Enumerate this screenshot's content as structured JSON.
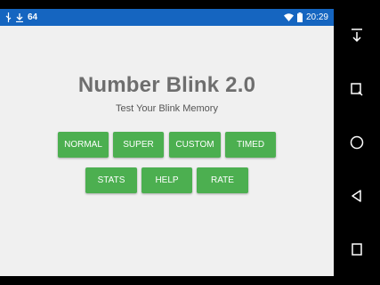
{
  "status_bar": {
    "notification_count": "64",
    "time": "20:29"
  },
  "app": {
    "title": "Number Blink 2.0",
    "subtitle": "Test Your Blink Memory"
  },
  "buttons": {
    "normal": "NORMAL",
    "super": "SUPER",
    "custom": "CUSTOM",
    "timed": "TIMED",
    "stats": "STATS",
    "help": "HELP",
    "rate": "RATE"
  },
  "nav": {
    "icons": [
      "collapse-icon",
      "screenshot-icon",
      "home-icon",
      "back-icon",
      "recents-icon"
    ]
  },
  "colors": {
    "status_bar": "#1565c0",
    "button": "#4caf50",
    "background": "#f0f0f0"
  }
}
